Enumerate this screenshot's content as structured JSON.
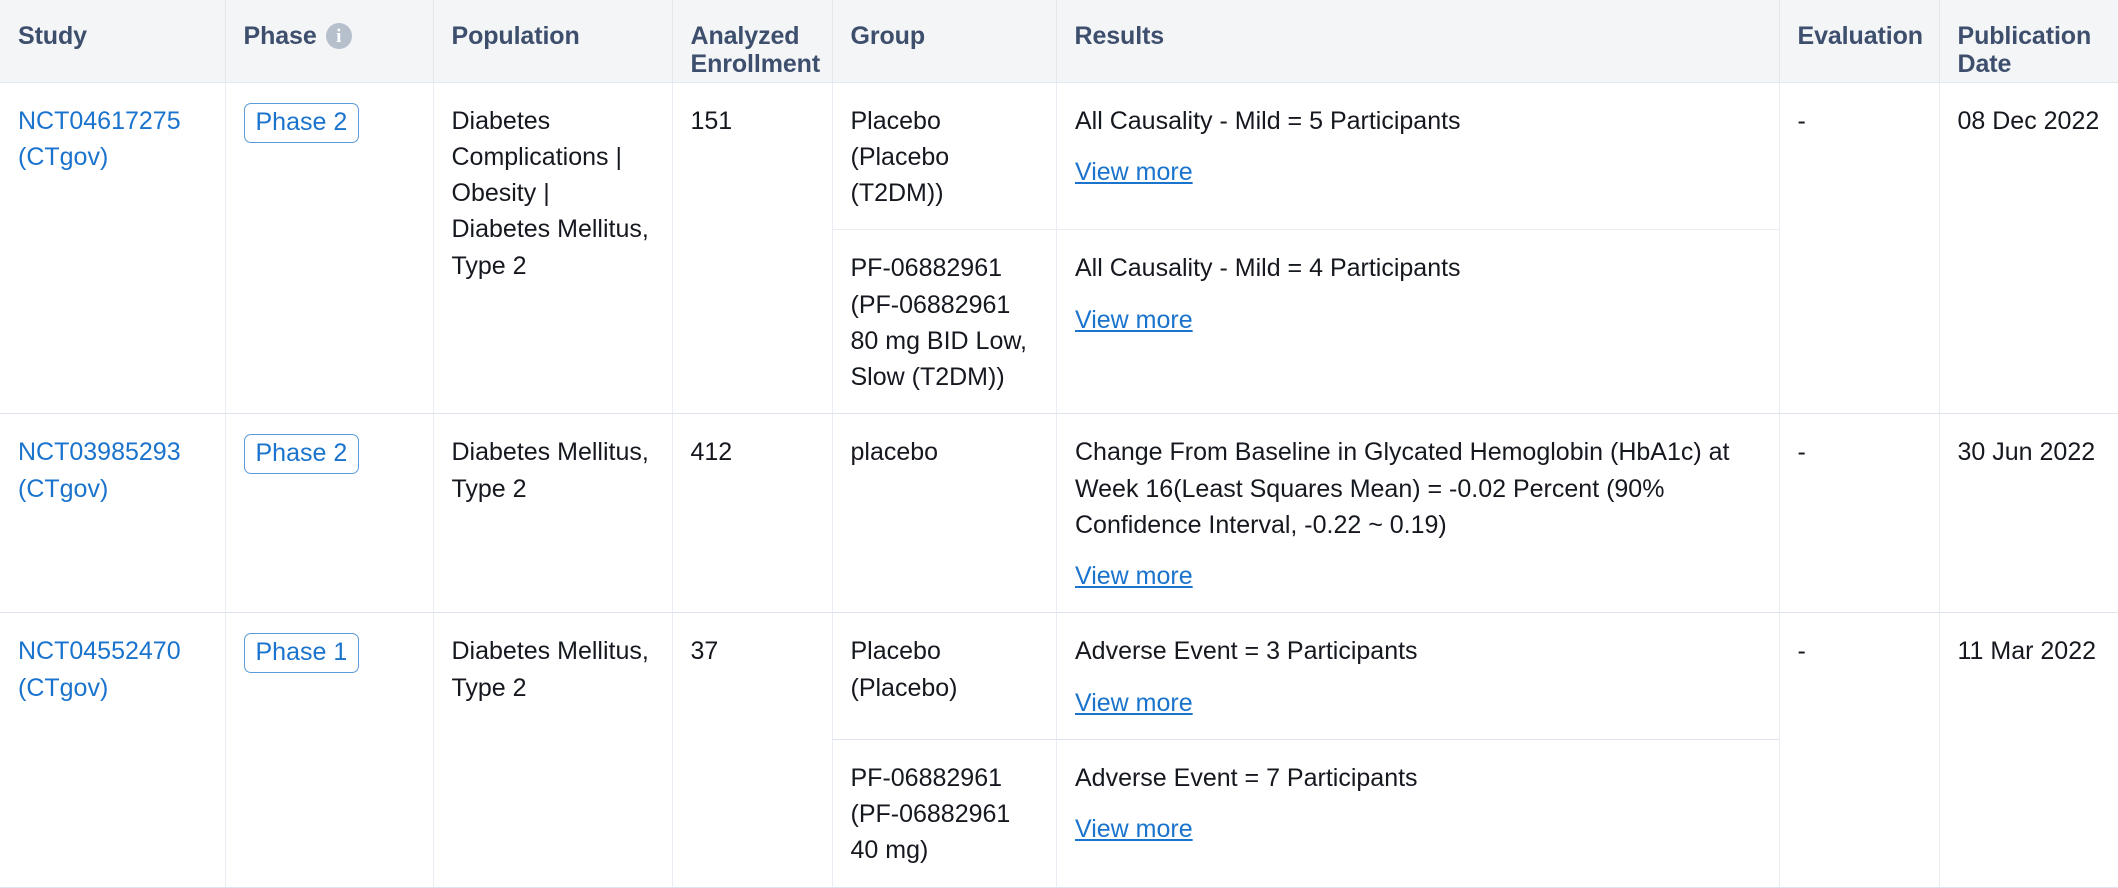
{
  "table": {
    "columns": [
      {
        "key": "study",
        "label": "Study"
      },
      {
        "key": "phase",
        "label": "Phase",
        "icon": "info-icon",
        "icon_glyph": "i"
      },
      {
        "key": "population",
        "label": "Population"
      },
      {
        "key": "enrollment",
        "label": "Analyzed Enrollment"
      },
      {
        "key": "group",
        "label": "Group"
      },
      {
        "key": "results",
        "label": "Results"
      },
      {
        "key": "evaluation",
        "label": "Evaluation"
      },
      {
        "key": "pubdate",
        "label": "Publication Date"
      }
    ],
    "view_more_label": "View more",
    "rows": [
      {
        "study_id": "NCT04617275",
        "study_source": "(CTgov)",
        "phase": "Phase 2",
        "population": "Diabetes Complications | Obesity | Diabetes Mellitus, Type 2",
        "enrollment": "151",
        "evaluation": "-",
        "publication_date": "08 Dec 2022",
        "groups": [
          {
            "group_name": "Placebo",
            "group_detail": "(Placebo (T2DM))",
            "result": "All Causality - Mild = 5 Participants"
          },
          {
            "group_name": "PF-06882961",
            "group_detail": "(PF-06882961 80 mg BID Low, Slow (T2DM))",
            "result": "All Causality - Mild = 4 Participants"
          }
        ]
      },
      {
        "study_id": "NCT03985293",
        "study_source": "(CTgov)",
        "phase": "Phase 2",
        "population": "Diabetes Mellitus, Type 2",
        "enrollment": "412",
        "evaluation": "-",
        "publication_date": "30 Jun 2022",
        "groups": [
          {
            "group_name": "placebo",
            "group_detail": "",
            "result": "Change From Baseline in Glycated Hemoglobin (HbA1c) at Week 16(Least Squares Mean) = -0.02 Percent (90% Confidence Interval, -0.22 ~ 0.19)"
          }
        ]
      },
      {
        "study_id": "NCT04552470",
        "study_source": "(CTgov)",
        "phase": "Phase 1",
        "population": "Diabetes Mellitus, Type 2",
        "enrollment": "37",
        "evaluation": "-",
        "publication_date": "11 Mar 2022",
        "groups": [
          {
            "group_name": "Placebo",
            "group_detail": "(Placebo)",
            "result": "Adverse Event = 3 Participants"
          },
          {
            "group_name": "PF-06882961",
            "group_detail": "(PF-06882961 40 mg)",
            "result": "Adverse Event = 7 Participants"
          }
        ]
      }
    ]
  },
  "colors": {
    "link": "#1a73cc",
    "header_bg": "#f4f5f7",
    "header_text": "#3d4f6d",
    "badge_border": "#5b9bd9",
    "border": "#e3e8ef"
  }
}
